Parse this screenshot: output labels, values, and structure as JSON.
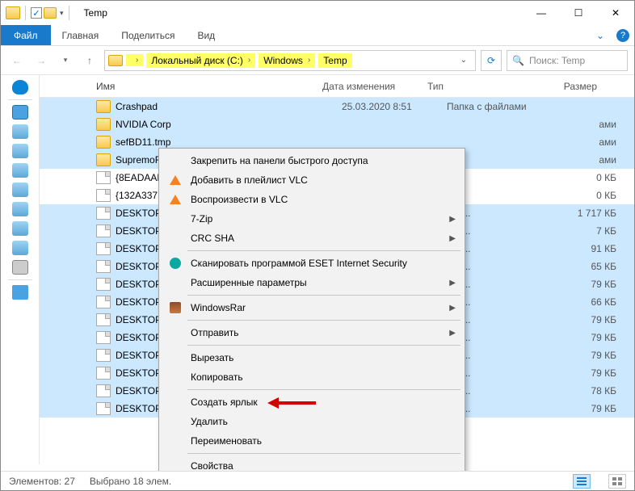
{
  "title": "Temp",
  "ribbon": {
    "file": "Файл",
    "home": "Главная",
    "share": "Поделиться",
    "view": "Вид"
  },
  "breadcrumb": {
    "seg1": "Локальный диск (C:)",
    "seg2": "Windows",
    "seg3": "Temp"
  },
  "search": {
    "placeholder": "Поиск: Temp"
  },
  "columns": {
    "name": "Имя",
    "date": "Дата изменения",
    "type": "Тип",
    "size": "Размер"
  },
  "files": [
    {
      "name": "Crashpad",
      "date": "25.03.2020 8:51",
      "type": "Папка с файлами",
      "size": "",
      "kind": "folder",
      "sel": true
    },
    {
      "name": "NVIDIA Corp",
      "date": "",
      "type": "",
      "size": "ами",
      "kind": "folder",
      "sel": true
    },
    {
      "name": "sefBD11.tmp",
      "date": "",
      "type": "",
      "size": "ами",
      "kind": "folder",
      "sel": true
    },
    {
      "name": "SupremoRe",
      "date": "",
      "type": "",
      "size": "ами",
      "kind": "folder",
      "sel": true
    },
    {
      "name": "{8EADAAB0",
      "date": "",
      "type": "",
      "size": "0 КБ",
      "kind": "tmp",
      "sel": false
    },
    {
      "name": "{132A337F-0",
      "date": "",
      "type": "",
      "size": "0 КБ",
      "kind": "tmp",
      "sel": false
    },
    {
      "name": "DESKTOP-30",
      "date": "",
      "type": "кум...",
      "size": "1 717 КБ",
      "kind": "tmp",
      "sel": true
    },
    {
      "name": "DESKTOP-30",
      "date": "",
      "type": "кум...",
      "size": "7 КБ",
      "kind": "tmp",
      "sel": true
    },
    {
      "name": "DESKTOP-30",
      "date": "",
      "type": "кум...",
      "size": "91 КБ",
      "kind": "tmp",
      "sel": true
    },
    {
      "name": "DESKTOP-30",
      "date": "",
      "type": "кум...",
      "size": "65 КБ",
      "kind": "tmp",
      "sel": true
    },
    {
      "name": "DESKTOP-30",
      "date": "",
      "type": "кум...",
      "size": "79 КБ",
      "kind": "tmp",
      "sel": true
    },
    {
      "name": "DESKTOP-30",
      "date": "",
      "type": "кум...",
      "size": "66 КБ",
      "kind": "tmp",
      "sel": true
    },
    {
      "name": "DESKTOP-30",
      "date": "",
      "type": "кум...",
      "size": "79 КБ",
      "kind": "tmp",
      "sel": true
    },
    {
      "name": "DESKTOP-30",
      "date": "",
      "type": "кум...",
      "size": "79 КБ",
      "kind": "tmp",
      "sel": true
    },
    {
      "name": "DESKTOP-30",
      "date": "",
      "type": "кум...",
      "size": "79 КБ",
      "kind": "tmp",
      "sel": true
    },
    {
      "name": "DESKTOP-30",
      "date": "",
      "type": "кум...",
      "size": "79 КБ",
      "kind": "tmp",
      "sel": true
    },
    {
      "name": "DESKTOP-30",
      "date": "",
      "type": "кум...",
      "size": "78 КБ",
      "kind": "tmp",
      "sel": true
    },
    {
      "name": "DESKTOP-30",
      "date": "",
      "type": "кум...",
      "size": "79 КБ",
      "kind": "tmp",
      "sel": true
    }
  ],
  "context_menu": {
    "pin": "Закрепить на панели быстрого доступа",
    "vlc_add": "Добавить в плейлист VLC",
    "vlc_play": "Воспроизвести в VLC",
    "sevenzip": "7-Zip",
    "crc": "CRC SHA",
    "eset": "Сканировать программой ESET Internet Security",
    "advanced": "Расширенные параметры",
    "winrar": "WindowsRar",
    "sendto": "Отправить",
    "cut": "Вырезать",
    "copy": "Копировать",
    "shortcut": "Создать ярлык",
    "delete": "Удалить",
    "rename": "Переименовать",
    "props": "Свойства"
  },
  "status": {
    "count": "Элементов: 27",
    "selected": "Выбрано 18 элем."
  }
}
